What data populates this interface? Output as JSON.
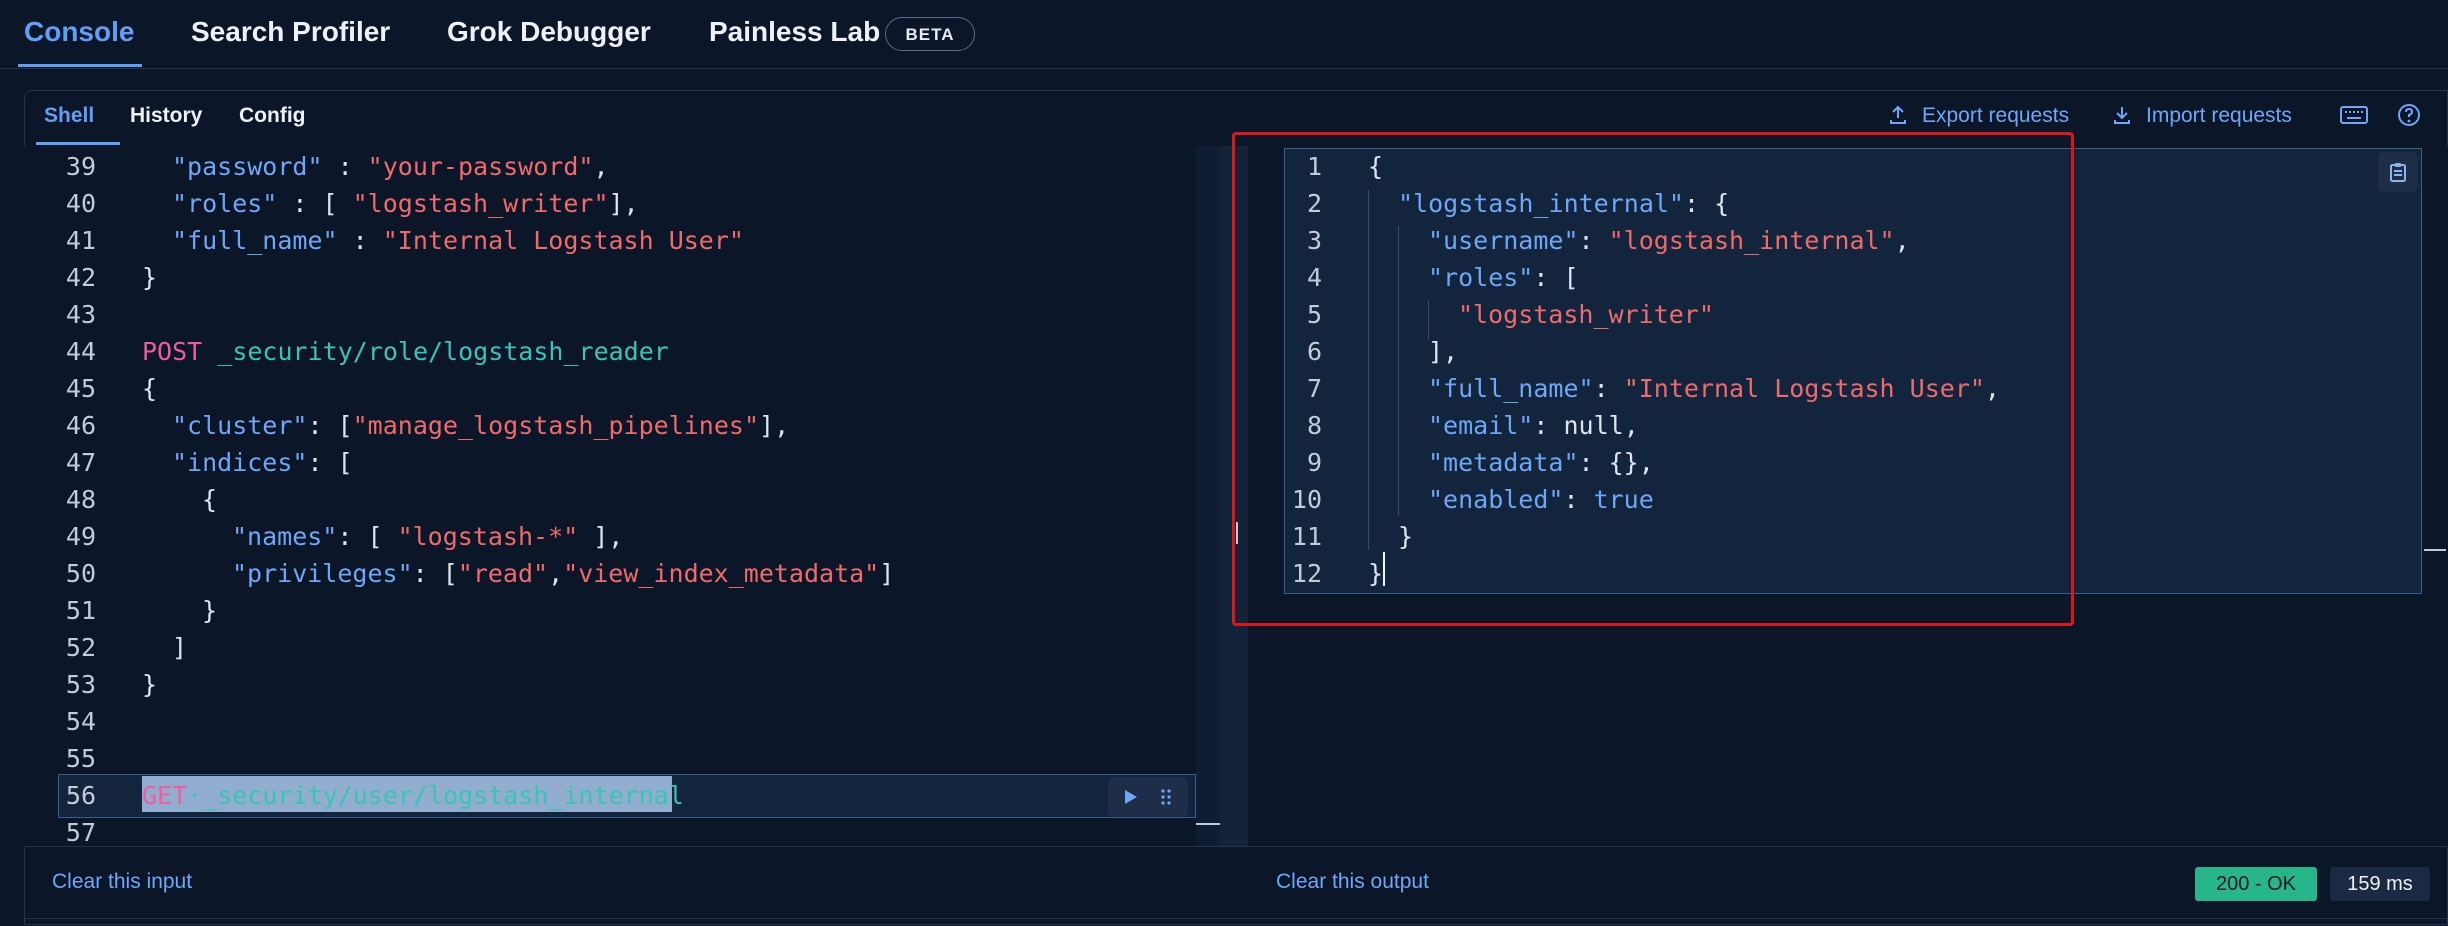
{
  "top_tabs": [
    {
      "label": "Console",
      "active": true
    },
    {
      "label": "Search Profiler"
    },
    {
      "label": "Grok Debugger"
    },
    {
      "label": "Painless Lab"
    }
  ],
  "beta_badge": "BETA",
  "sub_tabs": [
    {
      "label": "Shell",
      "active": true
    },
    {
      "label": "History"
    },
    {
      "label": "Config"
    }
  ],
  "actions": {
    "export": "Export requests",
    "import": "Import requests",
    "keyboard_icon": "keyboard-icon",
    "help_icon": "help-icon"
  },
  "editor": {
    "line_numbers": [
      "39",
      "40",
      "41",
      "42",
      "43",
      "44",
      "45",
      "46",
      "47",
      "48",
      "49",
      "50",
      "51",
      "52",
      "53",
      "54",
      "55",
      "56",
      "57"
    ],
    "lines": [
      {
        "key": "\"password\"",
        "sep": " : ",
        "val": "\"your-password\"",
        "tail": ","
      },
      {
        "key": "\"roles\"",
        "sep": " : [ ",
        "val": "\"logstash_writer\"",
        "tail": "],"
      },
      {
        "key": "\"full_name\"",
        "sep": " : ",
        "val": "\"Internal Logstash User\"",
        "tail": ""
      },
      {
        "text": "}"
      },
      {
        "text": ""
      },
      {
        "method": "POST",
        "path": "_security/role/logstash_reader"
      },
      {
        "text": "{"
      },
      {
        "key": "\"cluster\"",
        "sep": ": [",
        "val": "\"manage_logstash_pipelines\"",
        "tail": "],"
      },
      {
        "key": "\"indices\"",
        "sep": ": [",
        "val": "",
        "tail": ""
      },
      {
        "text": "{"
      },
      {
        "key": "\"names\"",
        "sep": ": [ ",
        "val": "\"logstash-*\"",
        "tail": " ],"
      },
      {
        "key": "\"privileges\"",
        "sep": ": [",
        "val": "\"read\"",
        "val2": "\"view_index_metadata\"",
        "tail": "]"
      },
      {
        "text": "}"
      },
      {
        "text": "]"
      },
      {
        "text": "}"
      },
      {
        "text": ""
      },
      {
        "text": ""
      },
      {
        "method": "GET",
        "path": "_security/user/logstash_internal"
      },
      {
        "text": ""
      }
    ]
  },
  "output": {
    "line_numbers": [
      "1",
      "2",
      "3",
      "4",
      "5",
      "6",
      "7",
      "8",
      "9",
      "10",
      "11",
      "12"
    ],
    "json": {
      "root_key": "\"logstash_internal\"",
      "username_key": "\"username\"",
      "username_val": "\"logstash_internal\"",
      "roles_key": "\"roles\"",
      "roles_val": "\"logstash_writer\"",
      "full_name_key": "\"full_name\"",
      "full_name_val": "\"Internal Logstash User\"",
      "email_key": "\"email\"",
      "email_val": "null",
      "metadata_key": "\"metadata\"",
      "metadata_val": "{}",
      "enabled_key": "\"enabled\"",
      "enabled_val": "true"
    }
  },
  "footer": {
    "clear_input": "Clear this input",
    "clear_output": "Clear this output",
    "status": "200 - OK",
    "time": "159 ms"
  },
  "colors": {
    "accent": "#5ea0f5",
    "string": "#ef6b6b",
    "method": "#ef5d9e",
    "path": "#39c4b5",
    "status_ok": "#27b58a",
    "highlight_box": "#e01616"
  }
}
